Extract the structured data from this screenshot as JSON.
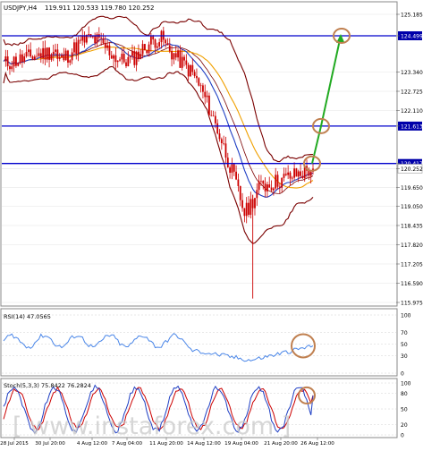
{
  "header": {
    "symbol_label": "USDJPY,H4",
    "ohlc_label": "119.911 120.533 119.780 120.252"
  },
  "rsi_panel": {
    "label": "RSI(14) 47.0565"
  },
  "stoch_panel": {
    "label": "Stoch(5,3,3) 75.8422 76.2824"
  },
  "watermark": {
    "text": "[ www.instaforex.com ]"
  },
  "colors": {
    "price_bars": "#cc0000",
    "bollinger": "#7a0000",
    "ma_fast": "#1f3fc4",
    "ma_slow": "#f0a000",
    "level_lines": "#0000cc",
    "target_arrow": "#22aa22",
    "highlight_circle": "#c08050",
    "rsi_line": "#4a86e8",
    "stoch_main": "#1f3fc4",
    "stoch_signal": "#cc0000"
  },
  "chart_data": [
    {
      "type": "candlestick",
      "title": "USDJPY,H4",
      "symbol": "USDJPY",
      "timeframe": "H4",
      "last_ohlc": {
        "open": 119.911,
        "high": 120.533,
        "low": 119.78,
        "close": 120.252
      },
      "y_ticks": [
        "125.185",
        "124.499",
        "123.340",
        "122.725",
        "122.110",
        "121.613",
        "120.417",
        "120.252",
        "119.650",
        "119.050",
        "118.435",
        "117.820",
        "117.205",
        "116.590",
        "115.975"
      ],
      "ylim": [
        115.975,
        125.185
      ],
      "x_ticks": [
        "28 Jul 2015",
        "30 Jul 20:00",
        "4 Aug 12:00",
        "7 Aug 04:00",
        "11 Aug 20:00",
        "14 Aug 12:00",
        "19 Aug 04:00",
        "21 Aug 20:00",
        "26 Aug 12:00"
      ],
      "horizontal_levels": [
        124.499,
        121.613,
        120.417
      ],
      "highlighted_levels": [
        120.417,
        121.613,
        124.499
      ],
      "current_price": 120.252,
      "projection": [
        "120.417",
        "121.613",
        "124.499"
      ],
      "overlays": [
        "Bollinger Bands",
        "Moving average (fast)",
        "Moving average (slow)"
      ]
    },
    {
      "type": "line",
      "title": "RSI(14) 47.0565",
      "y_ticks": [
        "100",
        "70",
        "50",
        "30",
        "0"
      ],
      "ylim": [
        0,
        100
      ],
      "current_value": 47.0565
    },
    {
      "type": "line",
      "title": "Stoch(5,3,3) 75.8422 76.2824",
      "y_ticks": [
        "100",
        "80",
        "50",
        "20",
        "0"
      ],
      "ylim": [
        0,
        100
      ],
      "series": [
        {
          "name": "Main",
          "current_value": 75.8422
        },
        {
          "name": "Signal",
          "current_value": 76.2824
        }
      ]
    }
  ]
}
